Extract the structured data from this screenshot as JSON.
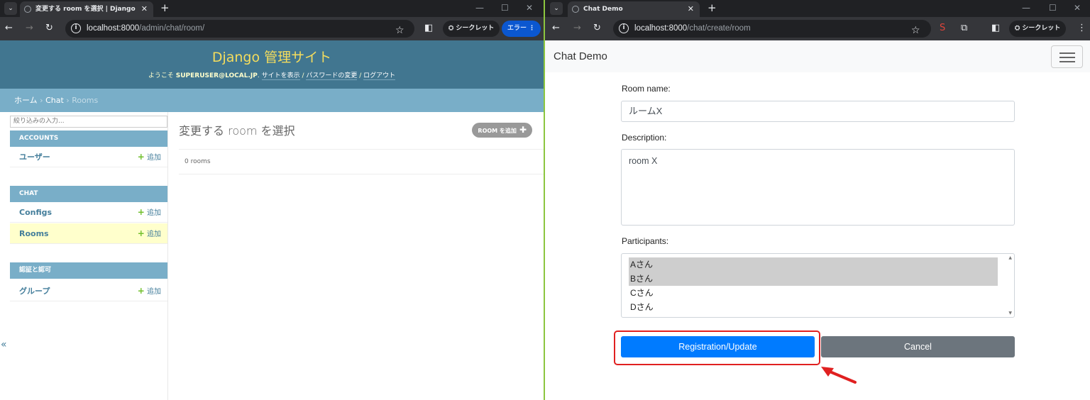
{
  "left_window": {
    "tab_title": "変更する room を選択 | Django",
    "url_host": "localhost:8000",
    "url_path": "/admin/chat/room/",
    "incognito_label": "シークレット",
    "error_label": "エラー",
    "header": {
      "branding": "Django 管理サイト",
      "welcome": "ようこそ",
      "username": "SUPERUSER@LOCAL.JP",
      "view_site": "サイトを表示",
      "change_password": "パスワードの変更",
      "logout": "ログアウト"
    },
    "breadcrumbs": {
      "home": "ホーム",
      "app": "Chat",
      "current": "Rooms"
    },
    "sidebar": {
      "filter_placeholder": "絞り込みの入力...",
      "add_label": "追加",
      "modules": [
        {
          "caption": "ACCOUNTS",
          "models": [
            "ユーザー"
          ]
        },
        {
          "caption": "CHAT",
          "models": [
            "Configs",
            "Rooms"
          ]
        },
        {
          "caption": "認証と認可",
          "models": [
            "グループ"
          ]
        }
      ],
      "collapse_glyph": "«"
    },
    "content": {
      "title": "変更する room を選択",
      "add_button": "ROOM を追加",
      "result_count": "0 rooms"
    }
  },
  "right_window": {
    "tab_title": "Chat Demo",
    "url_host": "localhost:8000",
    "url_path": "/chat/create/room",
    "incognito_label": "シークレット",
    "brand": "Chat Demo",
    "form": {
      "room_name_label": "Room name:",
      "room_name_value": "ルームX",
      "description_label": "Description:",
      "description_value": "room X",
      "participants_label": "Participants:",
      "participants": [
        {
          "name": "Aさん",
          "selected": true
        },
        {
          "name": "Bさん",
          "selected": true
        },
        {
          "name": "Cさん",
          "selected": false
        },
        {
          "name": "Dさん",
          "selected": false
        }
      ],
      "submit_label": "Registration/Update",
      "cancel_label": "Cancel"
    }
  },
  "colors": {
    "django_header": "#417690",
    "django_accent": "#79aec8",
    "primary_button": "#007bff",
    "secondary_button": "#6c757d",
    "highlight": "#e02020"
  }
}
